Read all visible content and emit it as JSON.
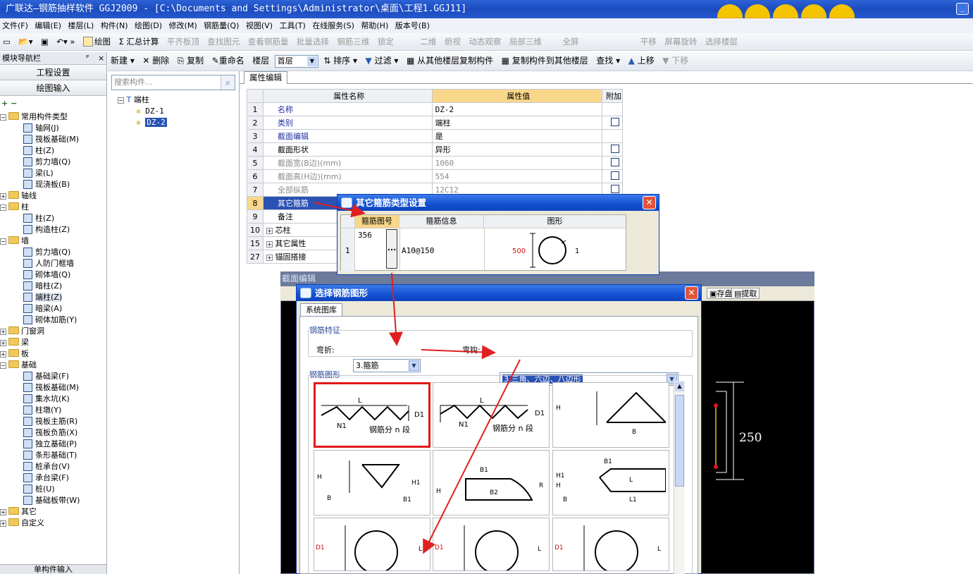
{
  "window": {
    "title": "广联达—钢筋抽样软件 GGJ2009 - [C:\\Documents and Settings\\Administrator\\桌面\\工程1.GGJ11]",
    "min_label": "_"
  },
  "mascots": {
    "badges": [
      "中",
      "▾",
      "R",
      "■",
      "✿"
    ]
  },
  "menu": [
    "文件(F)",
    "编辑(E)",
    "楼层(L)",
    "构件(N)",
    "绘图(D)",
    "修改(M)",
    "钢筋量(Q)",
    "视图(V)",
    "工具(T)",
    "在线服务(S)",
    "帮助(H)",
    "版本号(B)"
  ],
  "toolbar1": {
    "draw": "绘图",
    "sum": "Σ 汇总计算",
    "flat": "平齐板顶",
    "find": "查找图元",
    "view_qty": "查看钢筋量",
    "batch": "批量选择",
    "rebar3d": "钢筋三维",
    "lock": "锁定",
    "view2d": "二维",
    "top": "俯视",
    "orbit": "动态观察",
    "local3": "局部三维",
    "full": "全屏",
    "pan": "平移",
    "rotate": "屏幕旋转",
    "choose_floor": "选择楼层"
  },
  "nav": {
    "header": "模块导航栏",
    "pin": "ᴾ",
    "close": "×",
    "btn_setup": "工程设置",
    "btn_draw": "绘图输入",
    "plus": "+",
    "minus": "−",
    "bottom": "单构件输入",
    "tree": [
      {
        "lvl": 0,
        "pm": "−",
        "t": "常用构件类型",
        "folder": true
      },
      {
        "lvl": 1,
        "t": "轴网(J)"
      },
      {
        "lvl": 1,
        "t": "筏板基础(M)"
      },
      {
        "lvl": 1,
        "t": "柱(Z)"
      },
      {
        "lvl": 1,
        "t": "剪力墙(Q)"
      },
      {
        "lvl": 1,
        "t": "梁(L)"
      },
      {
        "lvl": 1,
        "t": "现浇板(B)"
      },
      {
        "lvl": 0,
        "pm": "+",
        "t": "轴线",
        "folder": true
      },
      {
        "lvl": 0,
        "pm": "−",
        "t": "柱",
        "folder": true
      },
      {
        "lvl": 1,
        "t": "柱(Z)"
      },
      {
        "lvl": 1,
        "t": "构造柱(Z)"
      },
      {
        "lvl": 0,
        "pm": "−",
        "t": "墙",
        "folder": true
      },
      {
        "lvl": 1,
        "t": "剪力墙(Q)"
      },
      {
        "lvl": 1,
        "t": "人防门框墙"
      },
      {
        "lvl": 1,
        "t": "砌体墙(Q)"
      },
      {
        "lvl": 1,
        "t": "暗柱(Z)"
      },
      {
        "lvl": 1,
        "t": "端柱(Z)",
        "hl": true
      },
      {
        "lvl": 1,
        "t": "暗梁(A)"
      },
      {
        "lvl": 1,
        "t": "砌体加筋(Y)"
      },
      {
        "lvl": 0,
        "pm": "+",
        "t": "门窗洞",
        "folder": true
      },
      {
        "lvl": 0,
        "pm": "+",
        "t": "梁",
        "folder": true
      },
      {
        "lvl": 0,
        "pm": "+",
        "t": "板",
        "folder": true
      },
      {
        "lvl": 0,
        "pm": "−",
        "t": "基础",
        "folder": true
      },
      {
        "lvl": 1,
        "t": "基础梁(F)"
      },
      {
        "lvl": 1,
        "t": "筏板基础(M)"
      },
      {
        "lvl": 1,
        "t": "集水坑(K)"
      },
      {
        "lvl": 1,
        "t": "柱墩(Y)"
      },
      {
        "lvl": 1,
        "t": "筏板主筋(R)"
      },
      {
        "lvl": 1,
        "t": "筏板负筋(X)"
      },
      {
        "lvl": 1,
        "t": "独立基础(P)"
      },
      {
        "lvl": 1,
        "t": "条形基础(T)"
      },
      {
        "lvl": 1,
        "t": "桩承台(V)"
      },
      {
        "lvl": 1,
        "t": "承台梁(F)"
      },
      {
        "lvl": 1,
        "t": "桩(U)"
      },
      {
        "lvl": 1,
        "t": "基础板带(W)"
      },
      {
        "lvl": 0,
        "pm": "+",
        "t": "其它",
        "folder": true
      },
      {
        "lvl": 0,
        "pm": "+",
        "t": "自定义",
        "folder": true
      }
    ]
  },
  "toolbar2": {
    "new": "新建",
    "delete": "删除",
    "copy": "复制",
    "rename": "重命名",
    "floor_label": "楼层",
    "floor_value": "首层",
    "sort": "排序",
    "filter": "过滤",
    "copy_from": "从其他楼层复制构件",
    "copy_to": "复制构件到其他楼层",
    "find": "查找",
    "up": "上移",
    "down": "下移"
  },
  "component_list": {
    "search_placeholder": "搜索构件...",
    "root": "端柱",
    "items": [
      "DZ-1",
      "DZ-2"
    ],
    "selected": "DZ-2"
  },
  "props": {
    "tab": "属性编辑",
    "headers": [
      "属性名称",
      "属性值",
      "附加"
    ],
    "rows": [
      {
        "n": "1",
        "name": "名称",
        "val": "DZ-2",
        "cb": false,
        "st": "blue"
      },
      {
        "n": "2",
        "name": "类别",
        "val": "端柱",
        "cb": true,
        "st": "blue"
      },
      {
        "n": "3",
        "name": "截面编辑",
        "val": "是",
        "cb": false,
        "st": "blue"
      },
      {
        "n": "4",
        "name": "截面形状",
        "val": "异形",
        "cb": true,
        "st": ""
      },
      {
        "n": "5",
        "name": "截面宽(B边)(mm)",
        "val": "1060",
        "cb": true,
        "st": "gray"
      },
      {
        "n": "6",
        "name": "截面高(H边)(mm)",
        "val": "554",
        "cb": true,
        "st": "gray"
      },
      {
        "n": "7",
        "name": "全部纵筋",
        "val": "12C12",
        "cb": true,
        "st": "gray"
      },
      {
        "n": "8",
        "name": "其它箍筋",
        "val": "",
        "cb": false,
        "st": "sel"
      },
      {
        "n": "9",
        "name": "备注",
        "val": "",
        "cb": false,
        "st": ""
      },
      {
        "n": "10",
        "name": "芯柱",
        "val": "",
        "cb": false,
        "st": "pm"
      },
      {
        "n": "15",
        "name": "其它属性",
        "val": "",
        "cb": false,
        "st": "pm"
      },
      {
        "n": "27",
        "name": "锚固搭接",
        "val": "",
        "cb": false,
        "st": "pm"
      }
    ]
  },
  "stirrup_dialog": {
    "title": "其它箍筋类型设置",
    "headers": [
      "箍筋图号",
      "箍筋信息",
      "图形"
    ],
    "row_no": "1",
    "code": "356",
    "ellipsis": "...",
    "info": "A10@150",
    "dim_left": "500",
    "dim_right": "1"
  },
  "section_editor": {
    "title": "截面编辑",
    "save": "存盘",
    "extract": "提取",
    "dim": "250"
  },
  "shape_dialog": {
    "title": "选择钢筋图形",
    "tab": "系统图库",
    "group_feature": "钢筋特征",
    "bend_label": "弯折:",
    "bend_value": "3.箍筋",
    "hook_label": "弯钩:",
    "hook_value": "3.三角、六边、八边形",
    "group_shapes": "钢筋图形",
    "shapes": [
      {
        "L": "L",
        "D1": "D1",
        "N1": "N1",
        "seg": "钢筋分 n 段"
      },
      {
        "L": "L",
        "D1": "D1",
        "N1": "N1",
        "seg": "钢筋分 n 段"
      },
      {
        "H": "H",
        "B": "B"
      },
      {
        "H": "H",
        "H1": "H1",
        "B": "B",
        "B1": "B1"
      },
      {
        "H": "H",
        "B1": "B1",
        "B2": "B2",
        "R": "R"
      },
      {
        "H1": "H1",
        "H": "H",
        "B": "B",
        "B1": "B1",
        "L": "L",
        "L1": "L1"
      },
      {
        "D1": "D1",
        "L": "L"
      },
      {
        "D1": "D1",
        "L": "L"
      },
      {
        "D1": "D1",
        "L": "L"
      }
    ]
  },
  "colors": {
    "title_blue": "#1c4bc0",
    "arrow": "#e02020",
    "highlight": "#e01818",
    "sel_row": "#2a52b4"
  }
}
